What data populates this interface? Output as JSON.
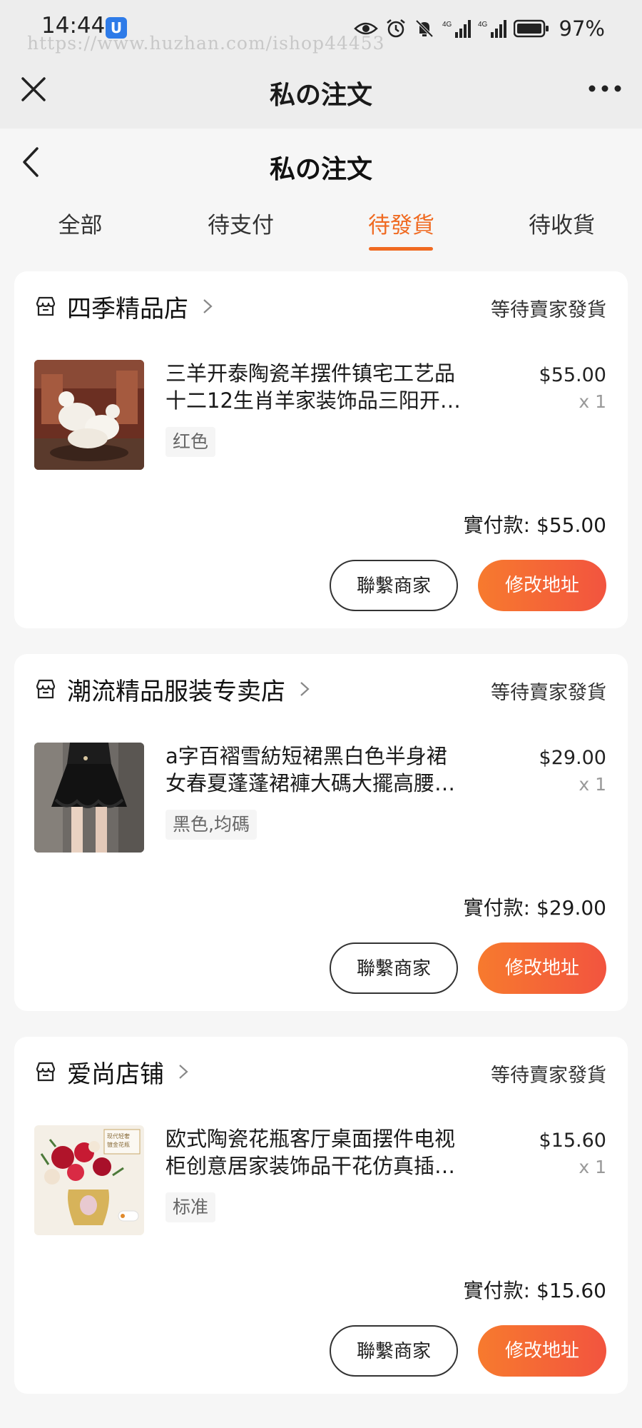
{
  "status_bar": {
    "time": "14:44",
    "app_badge": "U",
    "battery": "97%",
    "watermark": "https://www.huzhan.com/ishop44453",
    "net_1": "4G",
    "net_2": "4G"
  },
  "webview": {
    "title": "私の注文"
  },
  "page": {
    "title": "私の注文"
  },
  "tabs": [
    {
      "label": "全部",
      "active": false
    },
    {
      "label": "待支付",
      "active": false
    },
    {
      "label": "待發貨",
      "active": true
    },
    {
      "label": "待收貨",
      "active": false
    }
  ],
  "accent_color": "#f06a21",
  "orders": [
    {
      "store": "四季精品店",
      "status": "等待賣家發貨",
      "product_line1": "三羊开泰陶瓷羊摆件镇宅工艺品",
      "product_line2": "十二12生肖羊家装饰品三阳开…",
      "sku": "红色",
      "price": "$55.00",
      "qty": "x 1",
      "paid_label": "實付款:",
      "paid_amount": "$55.00",
      "btn_contact": "聯繫商家",
      "btn_address": "修改地址",
      "thumb": "ceramic-goats"
    },
    {
      "store": "潮流精品服装专卖店",
      "status": "等待賣家發貨",
      "product_line1": "a字百褶雪紡短裙黑白色半身裙",
      "product_line2": "女春夏蓬蓬裙褲大碼大擺高腰…",
      "sku": "黑色,均碼",
      "price": "$29.00",
      "qty": "x 1",
      "paid_label": "實付款:",
      "paid_amount": "$29.00",
      "btn_contact": "聯繫商家",
      "btn_address": "修改地址",
      "thumb": "black-skirt"
    },
    {
      "store": "爱尚店铺",
      "status": "等待賣家發貨",
      "product_line1": "欧式陶瓷花瓶客厅桌面摆件电视",
      "product_line2": "柜创意居家装饰品干花仿真插…",
      "sku": "标准",
      "price": "$15.60",
      "qty": "x 1",
      "paid_label": "實付款:",
      "paid_amount": "$15.60",
      "btn_contact": "聯繫商家",
      "btn_address": "修改地址",
      "thumb": "flower-vase",
      "thumb_label_1": "现代轻奢",
      "thumb_label_2": "镀金花瓶"
    }
  ]
}
